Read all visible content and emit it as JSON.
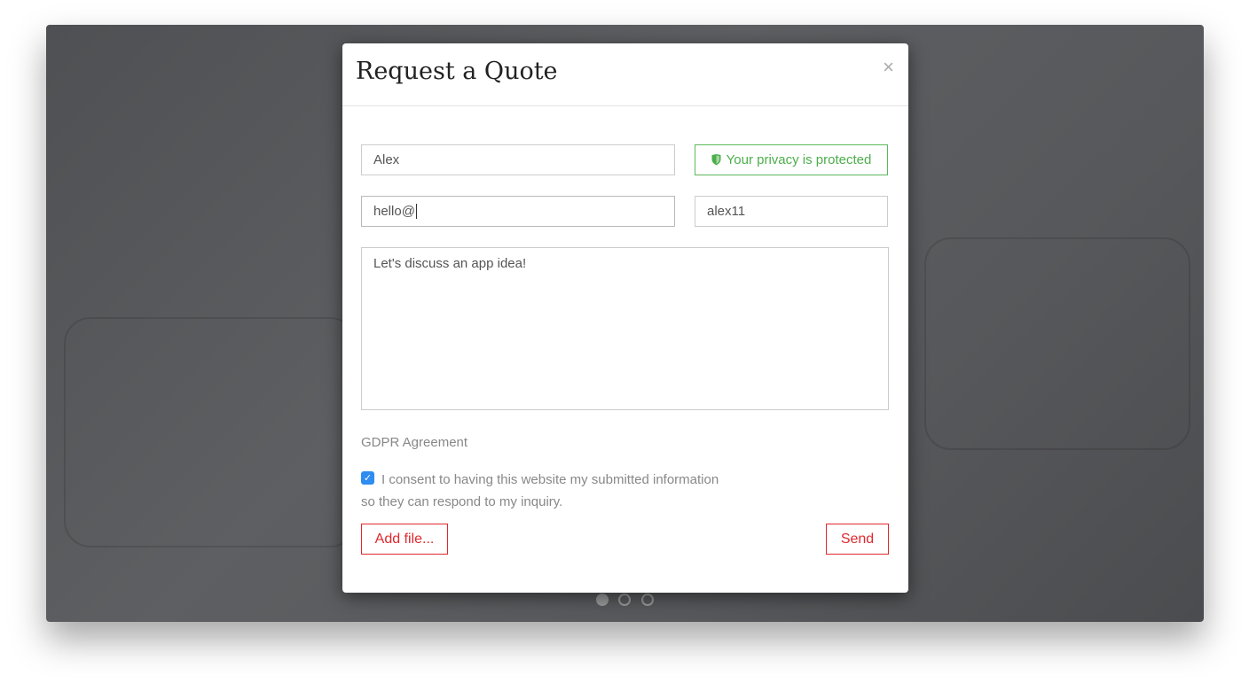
{
  "modal": {
    "title": "Request a Quote",
    "close_icon": "×",
    "name_value": "Alex",
    "privacy_label": "Your privacy is protected",
    "email_value": "hello@",
    "phone_value": "alex11",
    "message_value": "Let's discuss an app idea!",
    "gdpr_heading": "GDPR Agreement",
    "consent_checked": true,
    "consent_text": "I consent to having this website my submitted information so they can respond to my inquiry.",
    "add_file_label": "Add file...",
    "send_label": "Send"
  },
  "carousel": {
    "slides": 3,
    "active": 1
  },
  "colors": {
    "accent": "#e0282e",
    "success": "#4cae4c",
    "checkbox": "#2f8cf0"
  }
}
